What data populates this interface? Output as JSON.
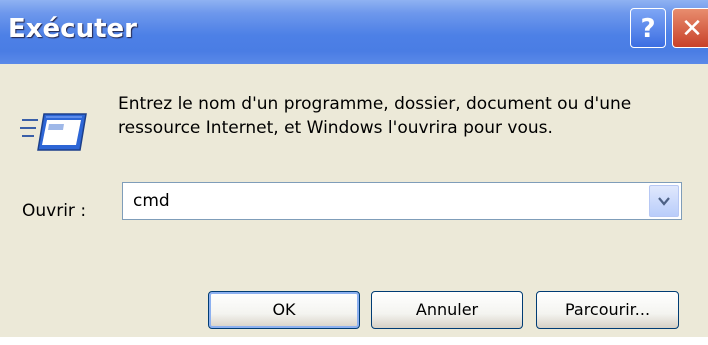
{
  "window": {
    "title": "Exécuter",
    "help_symbol": "?",
    "close_symbol": "✕",
    "titlebar_color": "#4a7de4",
    "client_color": "#ece9d8"
  },
  "dialog": {
    "icon": "run-icon",
    "description": "Entrez le nom d'un programme, dossier, document ou d'une ressource Internet, et Windows l'ouvrira pour vous.",
    "open_label": "Ouvrir :",
    "open_value": "cmd"
  },
  "buttons": {
    "ok": "OK",
    "cancel": "Annuler",
    "browse": "Parcourir..."
  }
}
